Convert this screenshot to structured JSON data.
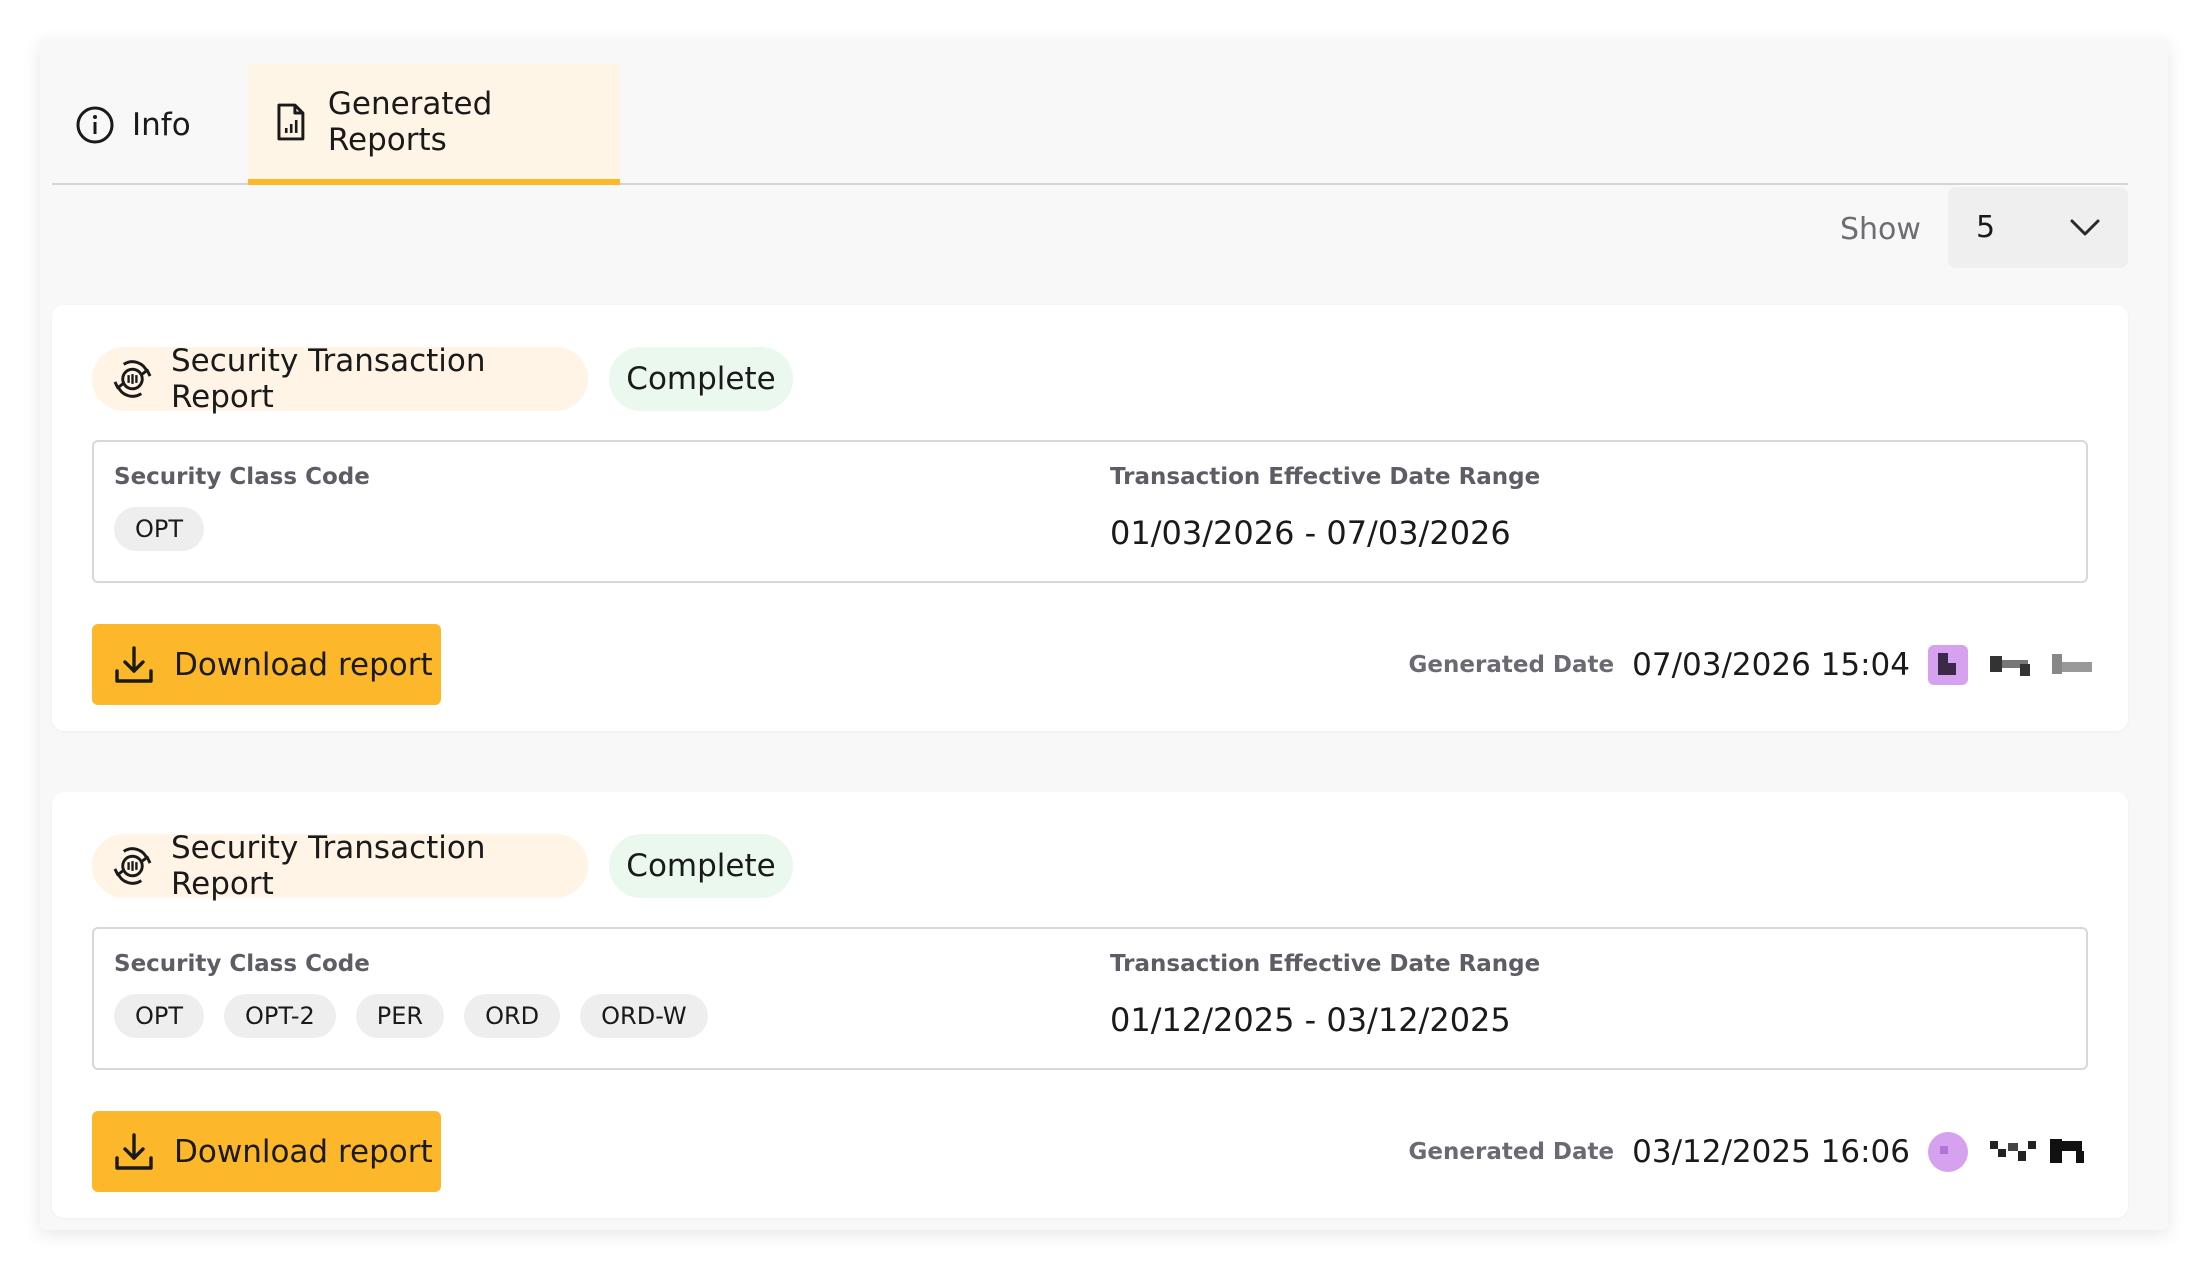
{
  "tabs": [
    {
      "label": "Info",
      "icon": "info-icon"
    },
    {
      "label": "Generated Reports",
      "icon": "report-file-icon",
      "active": true
    }
  ],
  "show": {
    "label": "Show",
    "value": "5"
  },
  "colors": {
    "accent": "#fdb72b",
    "status_bg": "#ebf8ee",
    "type_bg": "#fff4e5"
  },
  "reports": [
    {
      "type": "Security Transaction Report",
      "status": "Complete",
      "code_label": "Security Class Code",
      "codes": [
        "OPT"
      ],
      "range_label": "Transaction Effective Date Range",
      "range": "01/03/2026 - 07/03/2026",
      "download_label": "Download report",
      "generated_label": "Generated Date",
      "generated_date": "07/03/2026 15:04"
    },
    {
      "type": "Security Transaction Report",
      "status": "Complete",
      "code_label": "Security Class Code",
      "codes": [
        "OPT",
        "OPT-2",
        "PER",
        "ORD",
        "ORD-W"
      ],
      "range_label": "Transaction Effective Date Range",
      "range": "01/12/2025 - 03/12/2025",
      "download_label": "Download report",
      "generated_label": "Generated Date",
      "generated_date": "03/12/2025 16:06"
    }
  ]
}
